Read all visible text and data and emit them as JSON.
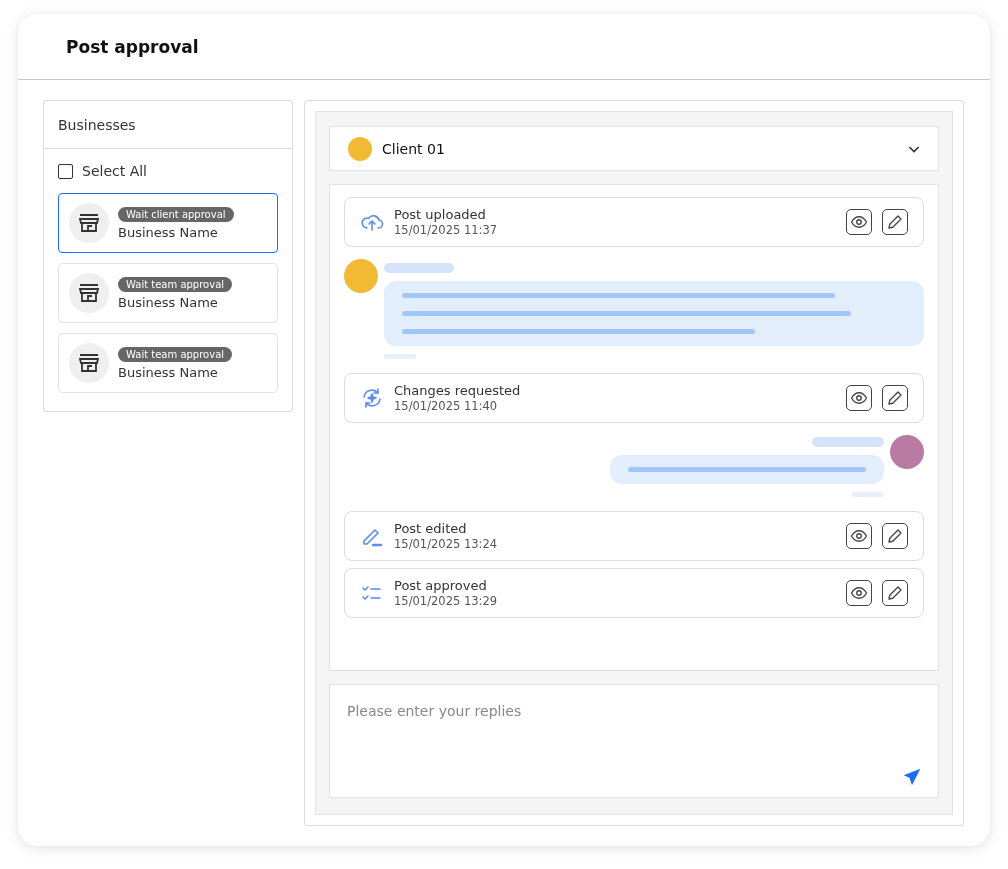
{
  "page": {
    "title": "Post approval"
  },
  "sidebar": {
    "title": "Businesses",
    "select_all": {
      "label": "Select All",
      "checked": false
    },
    "items": [
      {
        "badge": "Wait client approval",
        "name": "Business Name",
        "selected": true
      },
      {
        "badge": "Wait team approval",
        "name": "Business Name",
        "selected": false
      },
      {
        "badge": "Wait team approval",
        "name": "Business Name",
        "selected": false
      }
    ]
  },
  "client_select": {
    "value": "Client 01"
  },
  "timeline": [
    {
      "kind": "upload",
      "title": "Post uploaded",
      "time": "15/01/2025 11:37"
    },
    {
      "kind": "incoming"
    },
    {
      "kind": "changes",
      "title": "Changes requested",
      "time": "15/01/2025 11:40"
    },
    {
      "kind": "outgoing"
    },
    {
      "kind": "edit",
      "title": "Post edited",
      "time": "15/01/2025 13:24"
    },
    {
      "kind": "approved",
      "title": "Post approved",
      "time": "15/01/2025 13:29"
    }
  ],
  "reply": {
    "placeholder": "Please enter your replies"
  }
}
